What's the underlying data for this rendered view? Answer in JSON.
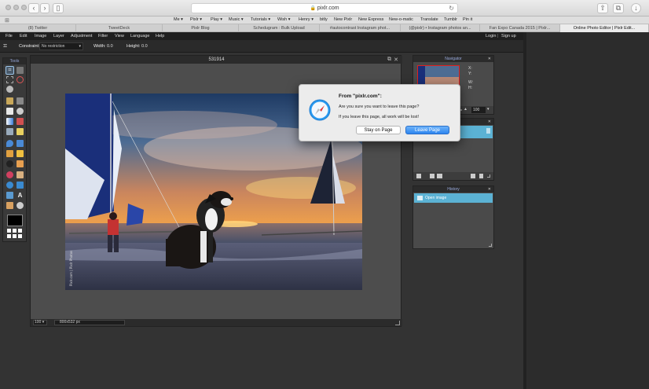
{
  "browser": {
    "url": "pixlr.com",
    "favorites": [
      "Me ▾",
      "Pixlr ▾",
      "Play ▾",
      "Music ▾",
      "Tutorials ▾",
      "Wish ▾",
      "Henry ▾",
      "bitly",
      "New Pixlr",
      "New Express",
      "New-o-matic",
      "Translate",
      "Tumblr",
      "Pin it"
    ],
    "tabs": [
      "(8) Twitter",
      "TweetDeck",
      "Pixlr Blog",
      "Schedugram : Bulk Upload",
      "#autocontrast Instagram phot...",
      "(@pixlr) • Instagram photos an...",
      "Fan Expo Canada 2015 | Pixlr...",
      "Online Photo Editor | Pixlr Edit..."
    ]
  },
  "app": {
    "menu": [
      "File",
      "Edit",
      "Image",
      "Layer",
      "Adjustment",
      "Filter",
      "View",
      "Language",
      "Help"
    ],
    "auth": {
      "login": "Login",
      "signup": "Sign up"
    },
    "options": {
      "constraint_label": "Constraint:",
      "constraint_value": "No restriction",
      "width_label": "Width:",
      "width_value": "0.0",
      "height_label": "Height:",
      "height_value": "0.0"
    },
    "tools_title": "Tools",
    "document": {
      "title": "531914",
      "zoom": "100",
      "dimensions": "800x532 px",
      "photo_credit": "Pixlr.com | Pixlr Photos"
    },
    "navigator": {
      "title": "Navigator",
      "x_label": "X:",
      "y_label": "Y:",
      "w_label": "W:",
      "h_label": "H:",
      "zoom": "100"
    },
    "history": {
      "title": "History",
      "items": [
        "Open image"
      ]
    }
  },
  "dialog": {
    "title": "From \"pixlr.com\":",
    "message": "Are you sure you want to leave this page?",
    "warning": "If you leave this page, all work will be lost!",
    "stay": "Stay on Page",
    "leave": "Leave Page"
  },
  "colors": {
    "accent": "#5bb2d4",
    "dialog_primary": "#2d85ef",
    "foreground_swatch": "#000000"
  }
}
